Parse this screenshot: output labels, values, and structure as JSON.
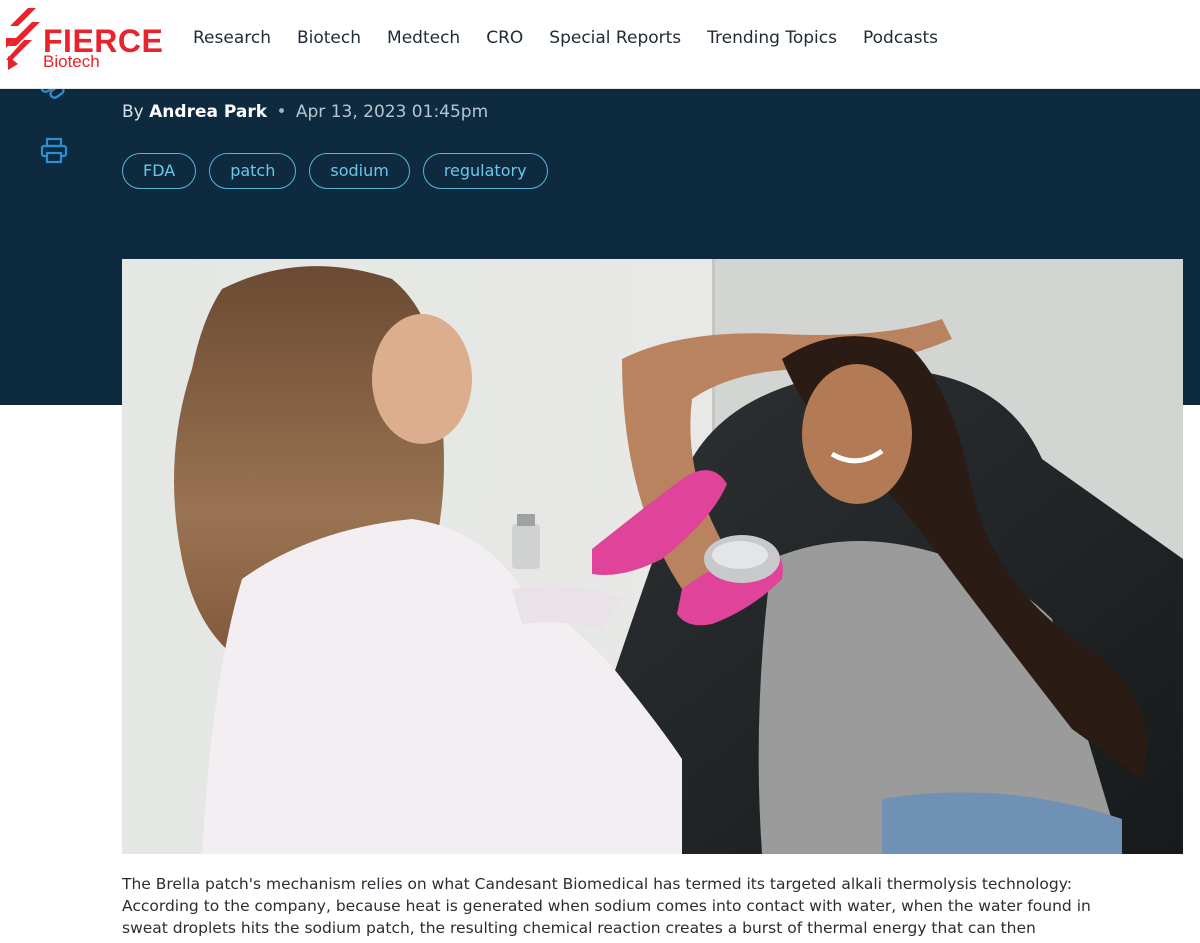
{
  "brand": {
    "name": "FIERCE",
    "section": "Biotech",
    "color": "#e8232b"
  },
  "nav": {
    "items": [
      {
        "label": "Research"
      },
      {
        "label": "Biotech"
      },
      {
        "label": "Medtech"
      },
      {
        "label": "CRO"
      },
      {
        "label": "Special Reports"
      },
      {
        "label": "Trending Topics"
      },
      {
        "label": "Podcasts"
      }
    ]
  },
  "article": {
    "by": "By",
    "author": "Andrea Park",
    "separator": "•",
    "date": "Apr 13, 2023 01:45pm",
    "tags": [
      "FDA",
      "patch",
      "sodium",
      "regulatory"
    ],
    "caption": "The Brella patch's mechanism relies on what Candesant Biomedical has termed its targeted alkali thermolysis technology: According to the company, because heat is generated when sodium comes into contact with water, when the water found in sweat droplets hits the sodium patch, the resulting chemical reaction creates a burst of thermal energy that can then"
  },
  "icons": {
    "share": "link-icon",
    "print": "printer-icon"
  },
  "colors": {
    "hero_bg": "#0d2a3f",
    "tag_border": "#56b5d8",
    "icon": "#2f8ed1"
  }
}
